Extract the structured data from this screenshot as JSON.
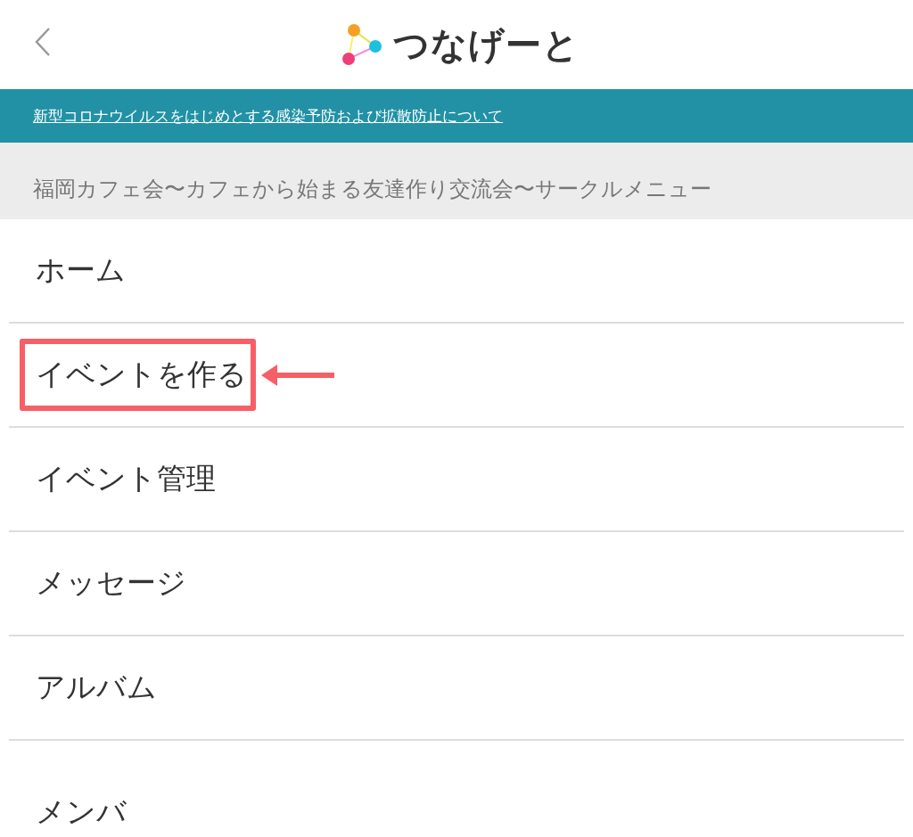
{
  "header": {
    "logo_text": "つなげーと"
  },
  "notice_banner": {
    "link": "新型コロナウイルスをはじめとする感染予防および拡散防止について"
  },
  "section_header": "福岡カフェ会〜カフェから始まる友達作り交流会〜サークルメニュー",
  "menu_items": [
    {
      "label": "ホーム",
      "highlighted": false
    },
    {
      "label": "イベントを作る",
      "highlighted": true
    },
    {
      "label": "イベント管理",
      "highlighted": false
    },
    {
      "label": "メッセージ",
      "highlighted": false
    },
    {
      "label": "アルバム",
      "highlighted": false
    },
    {
      "label": "メンバ",
      "highlighted": false
    }
  ]
}
